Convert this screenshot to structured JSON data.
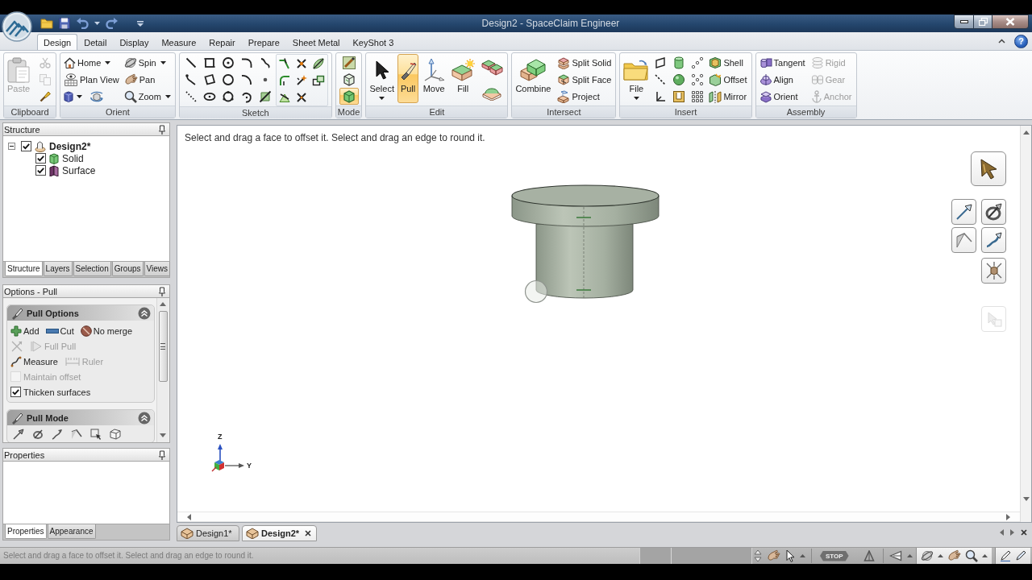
{
  "window": {
    "title": "Design2 - SpaceClaim Engineer"
  },
  "ribbon_tabs": [
    {
      "label": "Design",
      "selected": true
    },
    {
      "label": "Detail",
      "selected": false
    },
    {
      "label": "Display",
      "selected": false
    },
    {
      "label": "Measure",
      "selected": false
    },
    {
      "label": "Repair",
      "selected": false
    },
    {
      "label": "Prepare",
      "selected": false
    },
    {
      "label": "Sheet Metal",
      "selected": false
    },
    {
      "label": "KeyShot 3",
      "selected": false
    }
  ],
  "help_button": {
    "label": "?"
  },
  "ribbon_groups": [
    {
      "kind": "clipboard",
      "title": "Clipboard",
      "items": [
        {
          "label": "Paste",
          "disabled": true
        },
        {
          "disabled": true
        },
        {
          "disabled": true
        },
        {
          "disabled": false
        }
      ]
    },
    {
      "kind": "orient",
      "title": "Orient",
      "items": [
        {
          "label": "Home",
          "dropdown": true
        },
        {
          "label": "Spin",
          "dropdown": true
        },
        {
          "label": "Plan View"
        },
        {
          "label": "Pan"
        },
        {
          "label": "Zoom",
          "dropdown": true
        }
      ]
    },
    {
      "kind": "sketch",
      "title": "Sketch"
    },
    {
      "kind": "mode",
      "title": "Mode",
      "items": [
        {
          "selected": false
        },
        {
          "selected": false
        },
        {
          "selected": true
        }
      ]
    },
    {
      "kind": "edit",
      "title": "Edit",
      "items": [
        {
          "label": "Select",
          "dropdown": true,
          "selected": false
        },
        {
          "label": "Pull",
          "selected": true
        },
        {
          "label": "Move",
          "selected": false
        },
        {
          "label": "Fill",
          "selected": false
        }
      ]
    },
    {
      "kind": "intersect",
      "title": "Intersect",
      "items": [
        {
          "label": "Combine"
        },
        {
          "label": "Split Solid"
        },
        {
          "label": "Split Face"
        },
        {
          "label": "Project"
        }
      ]
    },
    {
      "kind": "insert",
      "title": "Insert",
      "items": [
        {
          "label": "File",
          "dropdown": true
        },
        {
          "label": "Shell"
        },
        {
          "label": "Offset"
        },
        {
          "label": "Mirror"
        }
      ]
    },
    {
      "kind": "assembly",
      "title": "Assembly",
      "items": [
        {
          "label": "Tangent",
          "disabled": false
        },
        {
          "label": "Align",
          "disabled": false
        },
        {
          "label": "Orient",
          "disabled": false
        },
        {
          "label": "Rigid",
          "disabled": true
        },
        {
          "label": "Gear",
          "disabled": true
        },
        {
          "label": "Anchor",
          "disabled": true
        }
      ]
    }
  ],
  "structure_panel": {
    "title": "Structure",
    "tree": [
      {
        "kind": "design",
        "label": "Design2*",
        "checked": true,
        "expanded": true,
        "children": [
          {
            "kind": "solid",
            "label": "Solid",
            "checked": true
          },
          {
            "kind": "surface",
            "label": "Surface",
            "checked": true
          }
        ]
      }
    ],
    "tabs": [
      {
        "label": "Structure",
        "selected": true
      },
      {
        "label": "Layers",
        "selected": false
      },
      {
        "label": "Selection",
        "selected": false
      },
      {
        "label": "Groups",
        "selected": false
      },
      {
        "label": "Views",
        "selected": false
      }
    ]
  },
  "options_panel": {
    "title": "Options - Pull",
    "sections": [
      {
        "kind": "rows",
        "title": "Pull Options",
        "expanded": true,
        "rows": [
          [
            {
              "kind": "button",
              "label": "Add",
              "disabled": false
            },
            {
              "kind": "button",
              "label": "Cut",
              "disabled": false
            },
            {
              "kind": "button",
              "label": "No merge",
              "disabled": false
            }
          ],
          [
            {
              "kind": "icon",
              "disabled": true
            },
            {
              "kind": "button",
              "label": "Full Pull",
              "disabled": true
            }
          ],
          [
            {
              "kind": "button",
              "label": "Measure",
              "disabled": false
            },
            {
              "kind": "button",
              "label": "Ruler",
              "disabled": true
            }
          ],
          [
            {
              "kind": "checkbox",
              "label": "Maintain offset",
              "checked": false,
              "disabled": true
            }
          ],
          [
            {
              "kind": "checkbox",
              "label": "Thicken surfaces",
              "checked": true,
              "disabled": false
            }
          ]
        ]
      },
      {
        "kind": "icons",
        "title": "Pull Mode",
        "expanded": true
      }
    ]
  },
  "properties_panel": {
    "title": "Properties",
    "tabs": [
      {
        "label": "Properties",
        "selected": true
      },
      {
        "label": "Appearance",
        "selected": false
      }
    ]
  },
  "viewport": {
    "hint": "Select and drag a face to offset it. Select and drag an edge to round it.",
    "axis_labels": {
      "z": "Z",
      "y": "Y"
    },
    "tool_guides": [
      {
        "kind": "large",
        "disabled": false
      },
      {
        "kind": "small",
        "disabled": false
      },
      {
        "kind": "small",
        "disabled": false
      },
      {
        "kind": "small",
        "disabled": false
      },
      {
        "kind": "small",
        "disabled": false
      },
      {
        "kind": "small",
        "disabled": false
      },
      {
        "kind": "small",
        "disabled": true
      }
    ]
  },
  "document_tabs": [
    {
      "label": "Design1*",
      "selected": false
    },
    {
      "label": "Design2*",
      "selected": true
    }
  ],
  "status_bar": {
    "text": "Select and drag a face to offset it. Select and drag an edge to round it.",
    "stop_button": "STOP"
  }
}
